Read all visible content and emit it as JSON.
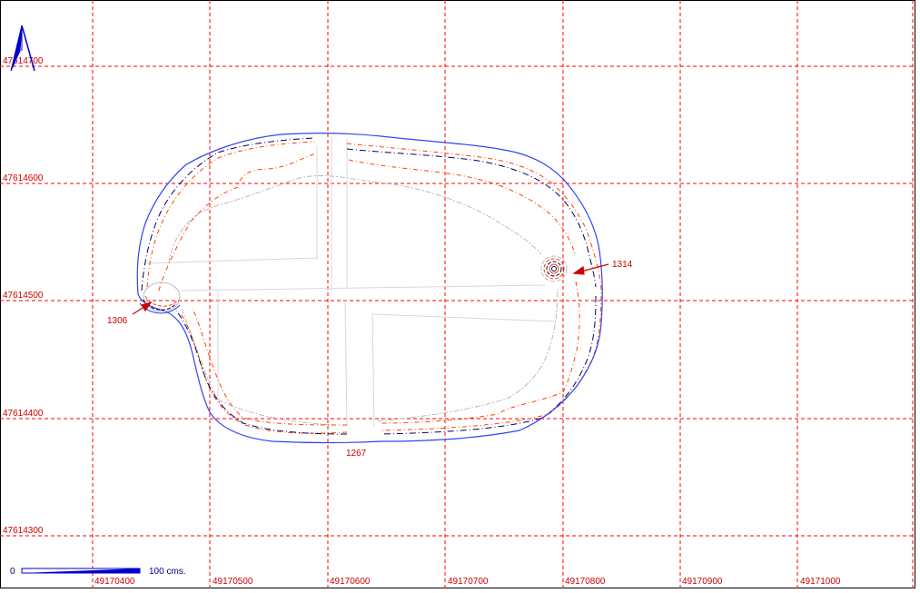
{
  "map": {
    "grid_x_labels": [
      "49170400",
      "49170500",
      "49170600",
      "49170700",
      "49170800",
      "49170900",
      "49171000"
    ],
    "grid_y_labels": [
      "47614700",
      "47614600",
      "47614500",
      "47614400",
      "47614300"
    ],
    "point_labels": {
      "p1314": "1314",
      "p1306": "1306",
      "p1267": "1267"
    },
    "scale_bar": {
      "zero_label": "0",
      "length_label": "100 cms."
    },
    "north_arrow_icon": "north-arrow-icon",
    "colors": {
      "grid": "#ff0000",
      "outer_contour": "#3344ee",
      "orange_contour": "#ff4400",
      "navy_contour": "#000066",
      "light_contour": "#bbbbbb",
      "labels": "#cc0000",
      "scale": "#0000cc"
    }
  }
}
